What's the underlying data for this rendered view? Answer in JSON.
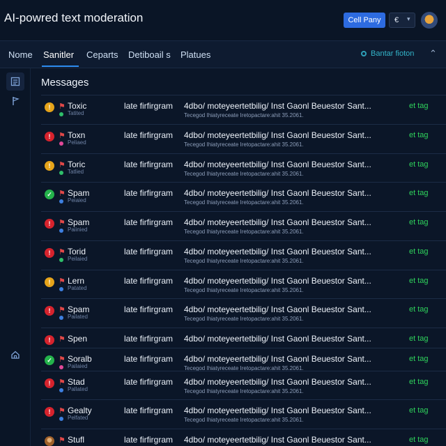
{
  "header": {
    "title": "AI-powred text moderation",
    "cta_label": "Cell Pany",
    "lang_value": "€",
    "lang_caret": "▾"
  },
  "nav": {
    "tabs": [
      {
        "label": "Nome"
      },
      {
        "label": "Sanitler"
      },
      {
        "label": "Ceparts"
      },
      {
        "label": "Detiboail s"
      },
      {
        "label": "Platues"
      }
    ],
    "active_tab": 1,
    "status_text": "Bantar fioton",
    "more": "⌃"
  },
  "sidebar": {
    "icons": [
      "message-list-icon",
      "flag-icon",
      "home-icon"
    ]
  },
  "main": {
    "title": "Messages",
    "rows": [
      {
        "label": "Toxic",
        "sub": "Tatited",
        "status": "warning",
        "status_color": "#e6a41a",
        "sub_color": "#2fbf6a",
        "source": "late firfirgram",
        "text": "4dbo/ moteyeertetbilig/ Inst Gaonl Beuestor Sant...",
        "meta": "Tecegod Ihiatyreceate Iretopactare:ahit 35.2061.",
        "action": "et tag"
      },
      {
        "label": "Toxn",
        "sub": "Peliaed",
        "status": "error",
        "status_color": "#d6232d",
        "sub_color": "#e04898",
        "source": "late firfirgram",
        "text": "4dbo/ moteyeertetbilig/ Inst Gaonl Beuestor Sant...",
        "meta": "Tecegod Ihiatyreceate Iretopactare:ahit 35.2061.",
        "action": "et tag"
      },
      {
        "label": "Toric",
        "sub": "Tatlied",
        "status": "warning",
        "status_color": "#e6a41a",
        "sub_color": "#2fbf6a",
        "source": "late firfirgram",
        "text": "4dbo/ moteyeertetbilig/ Inst Gaonl Beuestor Sant...",
        "meta": "Tecegod Ihiatyreceate Iretopactare:ahit 35.2061.",
        "action": "et tag"
      },
      {
        "label": "Spam",
        "sub": "Peiaied",
        "status": "ok",
        "status_color": "#24b34b",
        "sub_color": "#3d7fe0",
        "source": "late firfirgram",
        "text": "4dbo/ moteyeertetbilig/ Inst Gaonl Beuestor Sant...",
        "meta": "Tecegod Ihiatyreceate Iretopactare:ahit 35.2061.",
        "action": "et tag"
      },
      {
        "label": "Spam",
        "sub": "Paiinied",
        "status": "error",
        "status_color": "#d6232d",
        "sub_color": "#3d7fe0",
        "source": "late firfirgram",
        "text": "4dbo/ moteyeertetbilig/ Inst Gaonl Beuestor Sant...",
        "meta": "Tecegod Ihiatyreceate Iretopactare:ahit 35.2061.",
        "action": "et tag"
      },
      {
        "label": "Torid",
        "sub": "Peilaied",
        "status": "error",
        "status_color": "#d6232d",
        "sub_color": "#2fbf6a",
        "source": "late firfirgram",
        "text": "4dbo/ moteyeertetbilig/ Inst Gaonl Beuestor Sant...",
        "meta": "Tecegod Ihiatyreceate Iretopactare:ahit 35.2061.",
        "action": "et tag"
      },
      {
        "label": "Lern",
        "sub": "Patated",
        "status": "warning",
        "status_color": "#e6a41a",
        "sub_color": "#3d7fe0",
        "source": "late firfirgram",
        "text": "4dbo/ moteyeertetbilig/ Inst Gaonl Beuestor Sant...",
        "meta": "Tecegod Ihiatyreceate Iretopactare:ahit 35.2061.",
        "action": "et tag"
      },
      {
        "label": "Spam",
        "sub": "Pailated",
        "status": "error",
        "status_color": "#d6232d",
        "sub_color": "#3d7fe0",
        "source": "late firfirgram",
        "text": "4dbo/ moteyeertetbilig/ Inst Gaonl Beuestor Sant...",
        "meta": "Tecegod Ihiatyreceate Iretopactare:ahit 35.2061.",
        "action": "et tag"
      },
      {
        "label": "Spen",
        "sub": "",
        "status": "error",
        "status_color": "#d6232d",
        "sub_color": "#3d7fe0",
        "source": "late firfirgram",
        "text": "4dbo/ moteyeertetbilig/ Inst Gaonl Beuestor Sant...",
        "meta": "",
        "action": "et tag"
      },
      {
        "label": "Soralb",
        "sub": "Pailaied",
        "status": "ok",
        "status_color": "#24b34b",
        "sub_color": "#e04898",
        "source": "late firfirgram",
        "text": "4dbo/ moteyeertetbilig/ Inst Gaonl Beuestor Sant...",
        "meta": "Tecegod Ihiatyreceate Iretopactare:ahit 35.2061.",
        "action": "et tag"
      },
      {
        "label": "Stad",
        "sub": "Pallated",
        "status": "error",
        "status_color": "#d6232d",
        "sub_color": "#3d7fe0",
        "source": "late firfirgram",
        "text": "4dbo/ moteyeertetbilig/ Inst Gaonl Beuestor Sant...",
        "meta": "Tecegod Ihiatyreceate Iretopactare:ahit 35.2061.",
        "action": "et tag"
      },
      {
        "label": "Gealty",
        "sub": "Pelfated",
        "status": "error",
        "status_color": "#d6232d",
        "sub_color": "#3d7fe0",
        "source": "late firfirgram",
        "text": "4dbo/ moteyeertetbilig/ Inst Gaonl Beuestor Sant...",
        "meta": "Tecegod Ihiatyreceate Iretopactare:ahit 35.2061.",
        "action": "et tag"
      },
      {
        "label": "Stufl",
        "sub": "",
        "status": "avatar",
        "status_color": "#a0612a",
        "sub_color": "#3d7fe0",
        "source": "late firfirgram",
        "text": "4dbo/ moteyeertetbilig/ Inst Gaonl Beuestor Sant...",
        "meta": "",
        "action": "et tag"
      }
    ]
  }
}
